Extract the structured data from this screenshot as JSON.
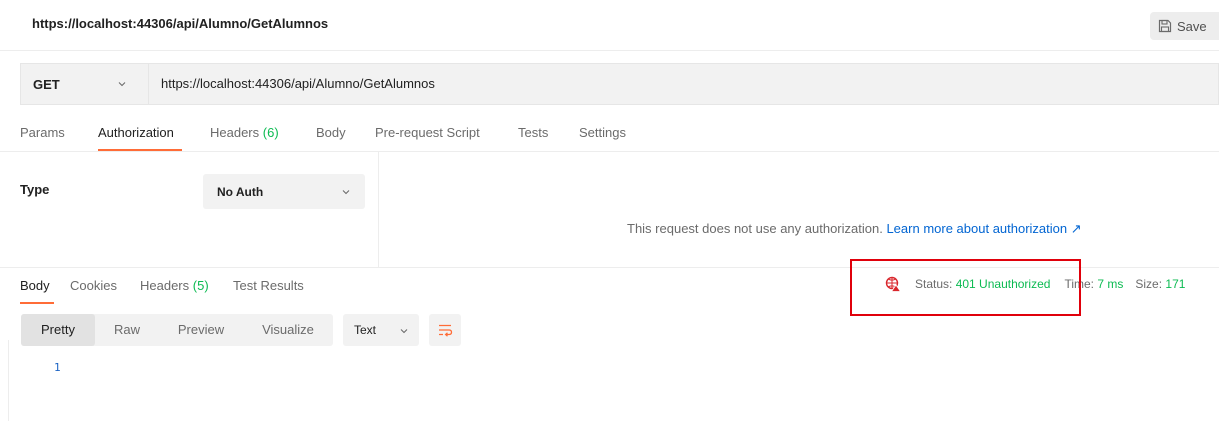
{
  "header": {
    "title": "https://localhost:44306/api/Alumno/GetAlumnos",
    "save_label": "Save"
  },
  "request": {
    "method": "GET",
    "url": "https://localhost:44306/api/Alumno/GetAlumnos"
  },
  "request_tabs": {
    "params": "Params",
    "authorization": "Authorization",
    "headers": "Headers",
    "headers_count": "(6)",
    "body": "Body",
    "prerequest": "Pre-request Script",
    "tests": "Tests",
    "settings": "Settings",
    "active": "Authorization"
  },
  "auth": {
    "type_label": "Type",
    "selected": "No Auth",
    "message": "This request does not use any authorization.",
    "link": "Learn more about authorization ↗"
  },
  "response_tabs": {
    "body": "Body",
    "cookies": "Cookies",
    "headers": "Headers",
    "headers_count": "(5)",
    "test_results": "Test Results",
    "active": "Body"
  },
  "status": {
    "status_label": "Status:",
    "status_value": "401 Unauthorized",
    "time_label": "Time:",
    "time_value": "7 ms",
    "size_label": "Size:",
    "size_value": "171"
  },
  "view": {
    "pretty": "Pretty",
    "raw": "Raw",
    "preview": "Preview",
    "visualize": "Visualize",
    "format": "Text",
    "active": "Pretty"
  },
  "editor": {
    "line_number": "1"
  },
  "colors": {
    "accent": "#ff6c37",
    "success": "#0cbb52",
    "link": "#0265d2",
    "highlight": "#e0000b"
  },
  "icons": {
    "save": "save-icon",
    "chevron": "chevron-down-icon",
    "network": "globe-warning-icon",
    "wrap": "word-wrap-icon",
    "external": "external-link-icon"
  }
}
